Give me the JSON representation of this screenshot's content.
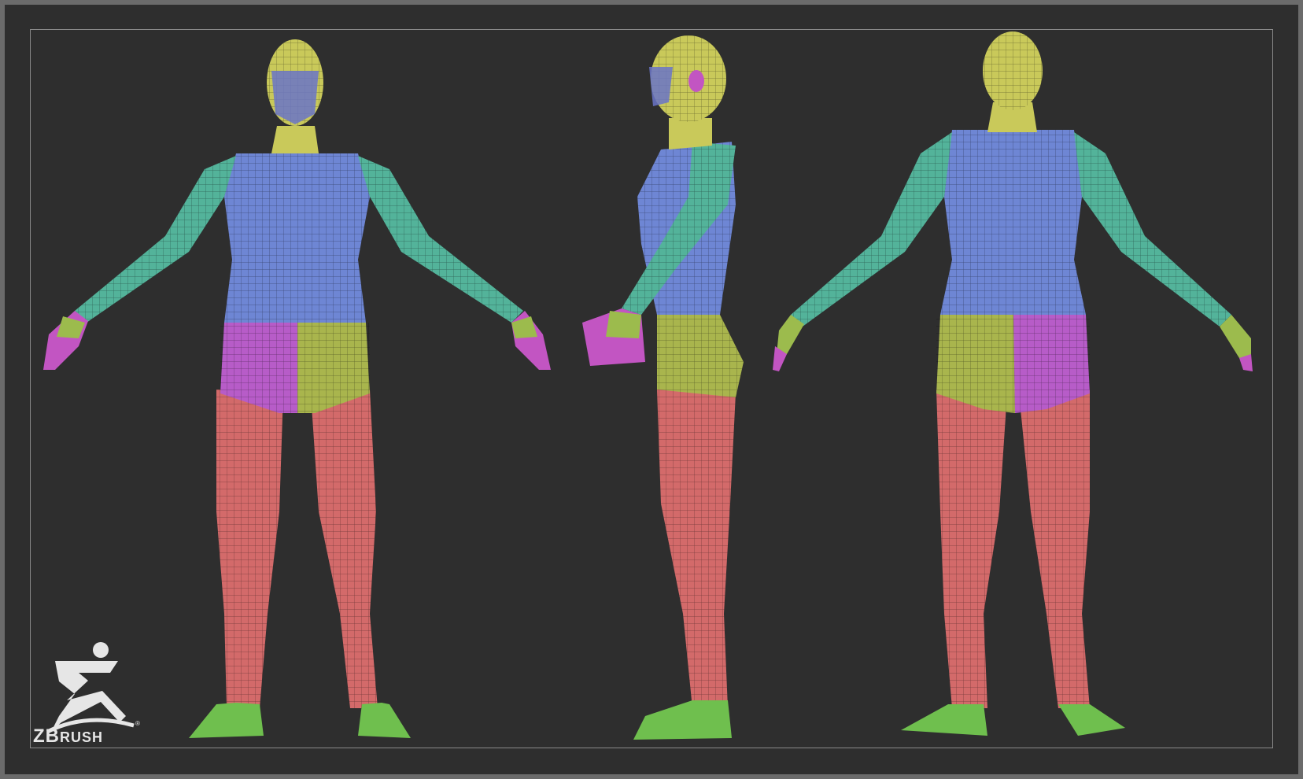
{
  "brand": {
    "logo_icon": "zbrush-figure-icon",
    "name_big": "ZB",
    "name_small": "RUSH",
    "trademark": "®"
  },
  "colors": {
    "background": "#2e2e2e",
    "frame": "#6b6b6b",
    "head": "#c9c95a",
    "torso": "#6e86d4",
    "arm": "#53b39a",
    "hand": "#9cbb4d",
    "fingers": "#c255c2",
    "hip_left": "#b75cc8",
    "hip_right": "#a9b54d",
    "leg": "#d36a6a",
    "foot": "#6fbf4e",
    "face_mask": "#6a74c8"
  },
  "views": [
    "front",
    "side",
    "back"
  ]
}
